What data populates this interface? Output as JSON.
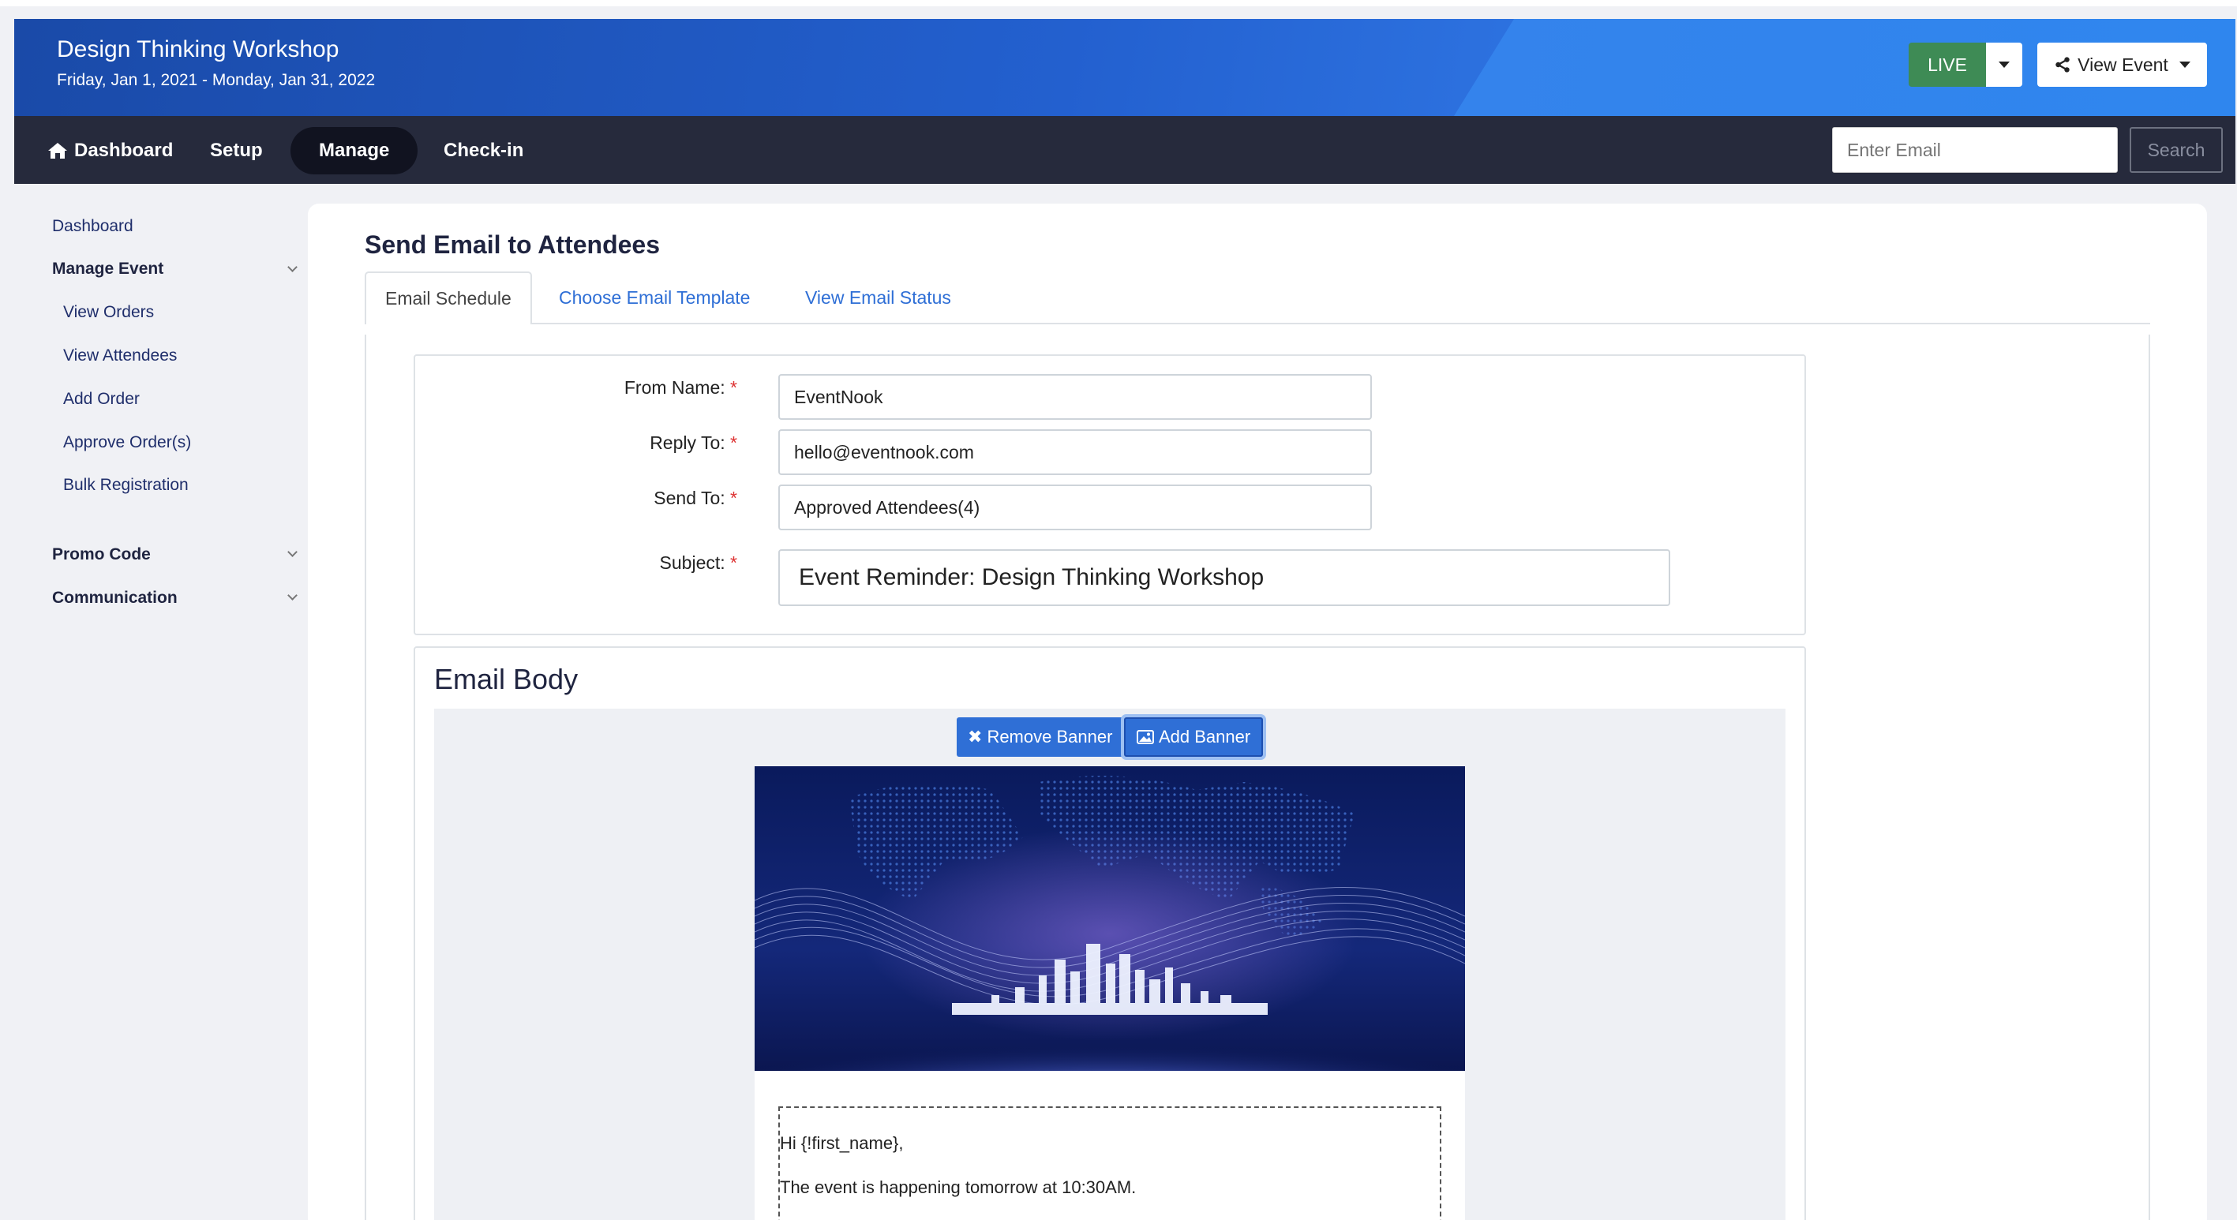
{
  "header": {
    "event_title": "Design Thinking Workshop",
    "event_dates": "Friday, Jan 1, 2021 - Monday, Jan 31, 2022",
    "live_label": "LIVE",
    "view_event_label": "View Event"
  },
  "navbar": {
    "items": [
      {
        "label": "Dashboard",
        "icon": "home-icon"
      },
      {
        "label": "Setup"
      },
      {
        "label": "Manage",
        "active": true
      },
      {
        "label": "Check-in"
      }
    ],
    "email_placeholder": "Enter Email",
    "search_label": "Search"
  },
  "sidebar": {
    "dashboard": "Dashboard",
    "manage_event": "Manage Event",
    "manage_items": [
      "View Orders",
      "View Attendees",
      "Add Order",
      "Approve Order(s)",
      "Bulk Registration"
    ],
    "promo_code": "Promo Code",
    "communication": "Communication"
  },
  "main": {
    "title": "Send Email to Attendees",
    "tabs": [
      "Email Schedule",
      "Choose Email Template",
      "View Email Status"
    ],
    "form": {
      "from_name_label": "From Name:",
      "from_name_value": "EventNook",
      "reply_to_label": "Reply To:",
      "reply_to_value": "hello@eventnook.com",
      "send_to_label": "Send To:",
      "send_to_value": "Approved Attendees(4)",
      "subject_label": "Subject:",
      "subject_value": "Event Reminder: Design Thinking Workshop",
      "required_mark": "*"
    },
    "email_body": {
      "title": "Email Body",
      "remove_banner": "Remove Banner",
      "add_banner": "Add Banner",
      "lines": [
        "Hi {!first_name},",
        "The event is happening tomorrow at 10:30AM."
      ]
    }
  },
  "colors": {
    "header_blue": "#2563d6",
    "navbar_dark": "#262a3c",
    "live_green": "#3e8b55",
    "link_blue": "#2f6fd6",
    "required_red": "#dd3333"
  }
}
